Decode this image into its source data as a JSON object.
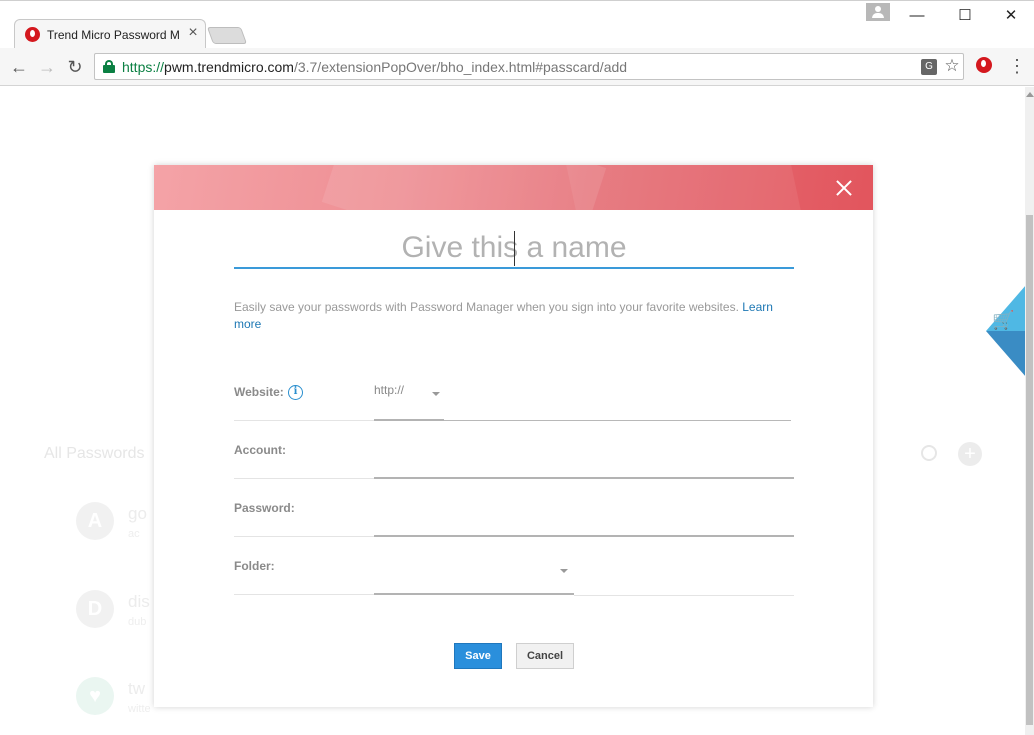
{
  "browser": {
    "tab_title": "Trend Micro Password M",
    "tab_close": "×",
    "url_scheme": "https://",
    "url_host": "pwm.trendmicro.com",
    "url_path": "/3.7/extensionPopOver/bho_index.html#passcard/add",
    "back": "←",
    "forward": "→",
    "reload": "↻",
    "minimize": "—",
    "maximize": "☐",
    "close": "✕",
    "star": "☆",
    "menu": "⋮",
    "translate": "G"
  },
  "background": {
    "section_title": "All Passwords",
    "add": "+",
    "items": [
      {
        "avatar": "A",
        "name": "go",
        "sub": "ac"
      },
      {
        "avatar": "D",
        "name": "dis",
        "sub": "dub"
      },
      {
        "avatar": "♥",
        "name": "tw",
        "sub": "witte"
      }
    ],
    "cart": "🛒"
  },
  "modal": {
    "name_placeholder": "Give this a name",
    "description": "Easily save your passwords with Password Manager when you sign into your favorite websites.",
    "learn_more": "Learn more",
    "website_label": "Website:",
    "info": "i",
    "scheme_value": "http://",
    "account_label": "Account:",
    "password_label": "Password:",
    "folder_label": "Folder:",
    "save_label": "Save",
    "cancel_label": "Cancel"
  }
}
